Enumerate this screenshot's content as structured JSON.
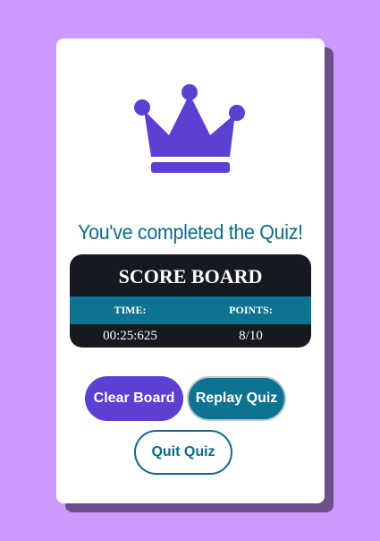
{
  "theme": {
    "background": "#cc99ff",
    "accent_purple": "#5d3fd3",
    "accent_teal": "#0d7390",
    "scoreboard_dark": "#16191f"
  },
  "icon": "crown-icon",
  "headline": "You've completed the Quiz!",
  "scoreboard": {
    "title": "SCORE BOARD",
    "time_label": "TIME:",
    "points_label": "POINTS:",
    "time_value": "00:25:625",
    "points_value": "8/10"
  },
  "buttons": {
    "clear": "Clear Board",
    "replay": "Replay Quiz",
    "quit": "Quit Quiz"
  }
}
